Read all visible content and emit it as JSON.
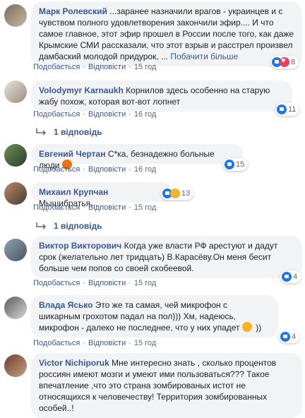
{
  "comments": [
    {
      "author": "Марк Ролевский",
      "text": "...заранее назначили врагов - украинцев и с чувством полного удовлетворения закончили эфир.... И что самое главное, этот эфир прошел в России после того, как даже Крымские СМИ рассказали, что этот взрыв и расстрел произвел дамбаский молодой придурок, ...",
      "more": "Побачити більше",
      "like": "Подобається",
      "reply": "Відповісти",
      "time": "15 год",
      "reaction_count": "8",
      "reactions": [
        "like-icon",
        "love-icon"
      ]
    },
    {
      "author": "Volodymyr Karnaukh",
      "text": "Корнилов здесь особенно на старую жабу похож, которая вот-вот лопнет",
      "like": "Подобається",
      "reply": "Відповісти",
      "time": "16 год",
      "reaction_count": "11",
      "reactions": [
        "like-icon"
      ],
      "replies": "1 відповідь"
    },
    {
      "author": "Евгений Чертан",
      "text": "С*ка, безнадежно больные люди",
      "emoji": "angry-emoji",
      "like": "Подобається",
      "reply": "Відповісти",
      "time": "16 год",
      "reaction_count": "15",
      "reactions": [
        "like-icon"
      ]
    },
    {
      "author": "Михаил Крупчан",
      "text": "Мышибратья...",
      "like": "Подобається",
      "reply": "Відповісти",
      "time": "15 год",
      "reaction_count": "13",
      "reactions": [
        "like-icon",
        "haha-icon"
      ],
      "replies": "1 відповідь"
    },
    {
      "author": "Виктор Викторович",
      "text": "Когда уже власти РФ арестуют и дадут срок (желательно лет тридцать) В.Карасёву.Он меня бесит больше чем попов со своей скобеевой.",
      "like": "Подобається",
      "reply": "Відповісти",
      "time": "15 год",
      "reaction_count": "4",
      "reactions": [
        "like-icon"
      ]
    },
    {
      "author": "Влада Ясько",
      "text": "Это же та самая, чей микрофон с шикарным грохотом падал на пол))) Хм, надеюсь, микрофон - далеко не последнее, что у них упадет",
      "text_tail": "))",
      "emoji": "facepalm-emoji",
      "like": "Подобається",
      "reply": "Відповісти",
      "time": "15 год",
      "reaction_count": "4",
      "reactions": [
        "like-icon"
      ]
    },
    {
      "author": "Victor Nichiporuk",
      "text": "Мне интересно знать , сколько процентов россиян имеют мозги и умеют ими пользоваться??? Такое впечатление ,что это страна зомбированых истот не относящихся к человечеству! Территория зомбированных особей..!",
      "reactions": []
    }
  ],
  "colors": {
    "link": "#385898",
    "bubble": "#f2f3f5",
    "meta": "#606770",
    "like": "#1877f2",
    "love": "#f33e58"
  }
}
